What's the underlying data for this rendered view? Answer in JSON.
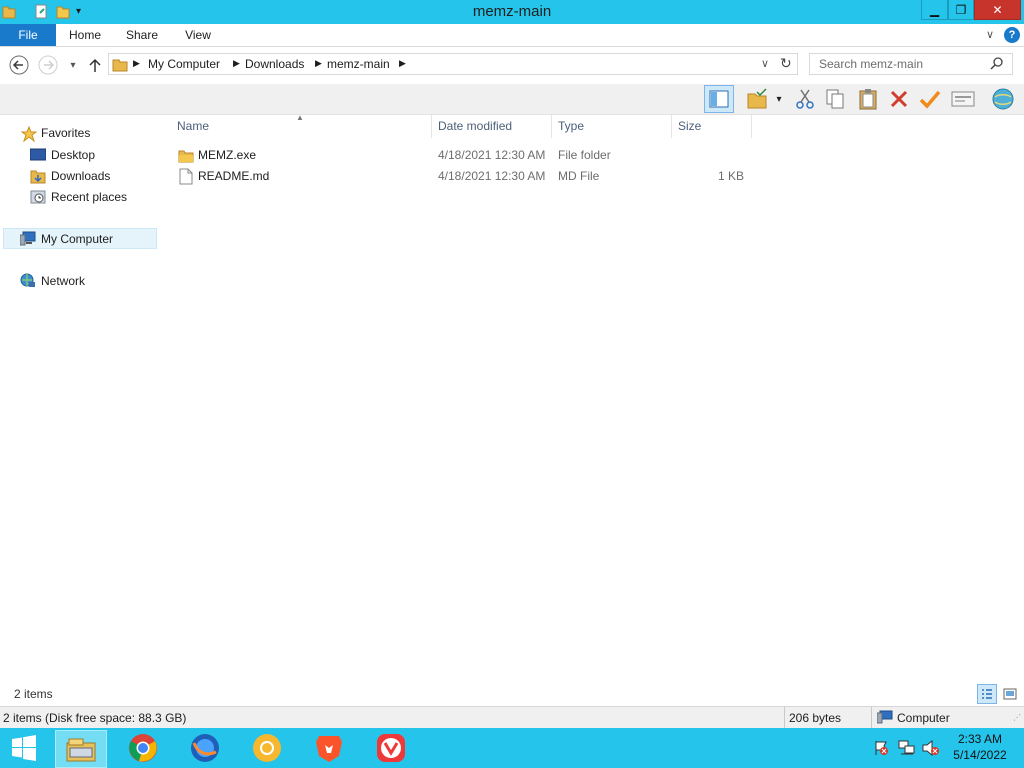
{
  "window": {
    "title": "memz-main"
  },
  "ribbon": {
    "tabs": [
      "File",
      "Home",
      "Share",
      "View"
    ]
  },
  "address": {
    "crumbs": [
      "My Computer",
      "Downloads",
      "memz-main"
    ]
  },
  "search": {
    "placeholder": "Search memz-main"
  },
  "nav": {
    "favorites": "Favorites",
    "fav_items": [
      "Desktop",
      "Downloads",
      "Recent places"
    ],
    "computer": "My Computer",
    "network": "Network"
  },
  "columns": [
    "Name",
    "Date modified",
    "Type",
    "Size"
  ],
  "files": [
    {
      "name": "MEMZ.exe",
      "date": "4/18/2021 12:30 AM",
      "type": "File folder",
      "size": ""
    },
    {
      "name": "README.md",
      "date": "4/18/2021 12:30 AM",
      "type": "MD File",
      "size": "1 KB"
    }
  ],
  "status": {
    "item_count": "2 items",
    "details": "2 items (Disk free space: 88.3 GB)",
    "bytes": "206 bytes",
    "location": "Computer"
  },
  "taskbar": {
    "apps": [
      "file-explorer",
      "chrome",
      "firefox",
      "chromium",
      "brave",
      "vivaldi"
    ],
    "time": "2:33 AM",
    "date": "5/14/2022"
  },
  "colors": {
    "accent": "#25c4ea",
    "file_tab": "#1979ca",
    "close": "#c7342b"
  }
}
